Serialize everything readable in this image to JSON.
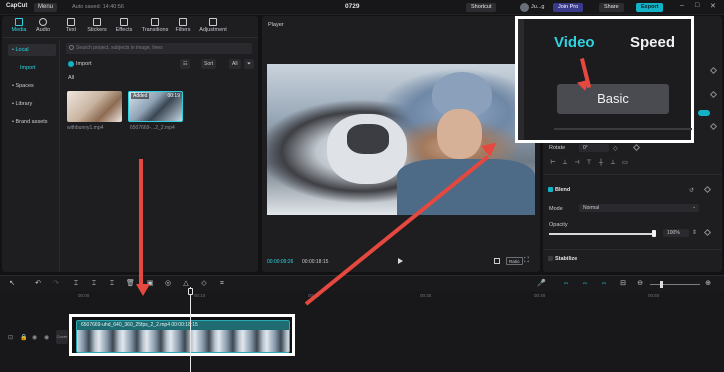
{
  "app": {
    "logo": "CapCut",
    "menu_label": "Menu",
    "autosave": "Auto saved: 14:40:56",
    "project_title": "0729",
    "shortcut_label": "Shortcut",
    "user_label": "Ju...g",
    "join_pro_label": "Join Pro",
    "share_label": "Share",
    "export_label": "Export"
  },
  "media_tabs": [
    {
      "label": "Media",
      "icon": "media-icon",
      "active": true
    },
    {
      "label": "Audio",
      "icon": "audio-icon",
      "active": false
    },
    {
      "label": "Text",
      "icon": "text-icon",
      "active": false
    },
    {
      "label": "Stickers",
      "icon": "stickers-icon",
      "active": false
    },
    {
      "label": "Effects",
      "icon": "effects-icon",
      "active": false
    },
    {
      "label": "Transitions",
      "icon": "transitions-icon",
      "active": false
    },
    {
      "label": "Filters",
      "icon": "filters-icon",
      "active": false
    },
    {
      "label": "Adjustment",
      "icon": "adjustment-icon",
      "active": false
    }
  ],
  "media_sidebar": {
    "local": "• Local",
    "import": "Import",
    "spaces": "• Spaces",
    "library": "• Library",
    "brand": "• Brand assets"
  },
  "media": {
    "search_placeholder": "Search project, subjects in image, lines",
    "import_label": "Import",
    "sort_label": "Sort",
    "filter_label": "All",
    "all_label": "All",
    "items": [
      {
        "name": "withbunny1.mp4",
        "badge": "",
        "duration": ""
      },
      {
        "name": "6507669-...2_2.mp4",
        "badge": "Added",
        "duration": "00:19"
      }
    ]
  },
  "player": {
    "title": "Player",
    "current_time": "00:00:09:26",
    "total_time": "00:00:18:15",
    "ratio_label": "Ratio"
  },
  "inspector": {
    "rotate_label": "Rotate",
    "rotate_value": "0°",
    "blend_label": "Blend",
    "mode_label": "Mode",
    "mode_value": "Normal",
    "opacity_label": "Opacity",
    "opacity_value": "100%",
    "opacity_level": 1.0,
    "stabilize_label": "Stabilize"
  },
  "zoom_callout": {
    "tab_video": "Video",
    "tab_speed": "Speed",
    "basic_label": "Basic"
  },
  "timeline": {
    "ruler": [
      "00:00",
      "00:10",
      "00:20",
      "00:30",
      "00:40",
      "00:50"
    ],
    "cover_label": "Cover",
    "clip_label": "6507669-uhd_640_360_25fps_2_2.mp4   00:00:18:15"
  },
  "colors": {
    "accent": "#2fd3e0",
    "export": "#12b3c6",
    "annotation_red": "#e5483f"
  }
}
